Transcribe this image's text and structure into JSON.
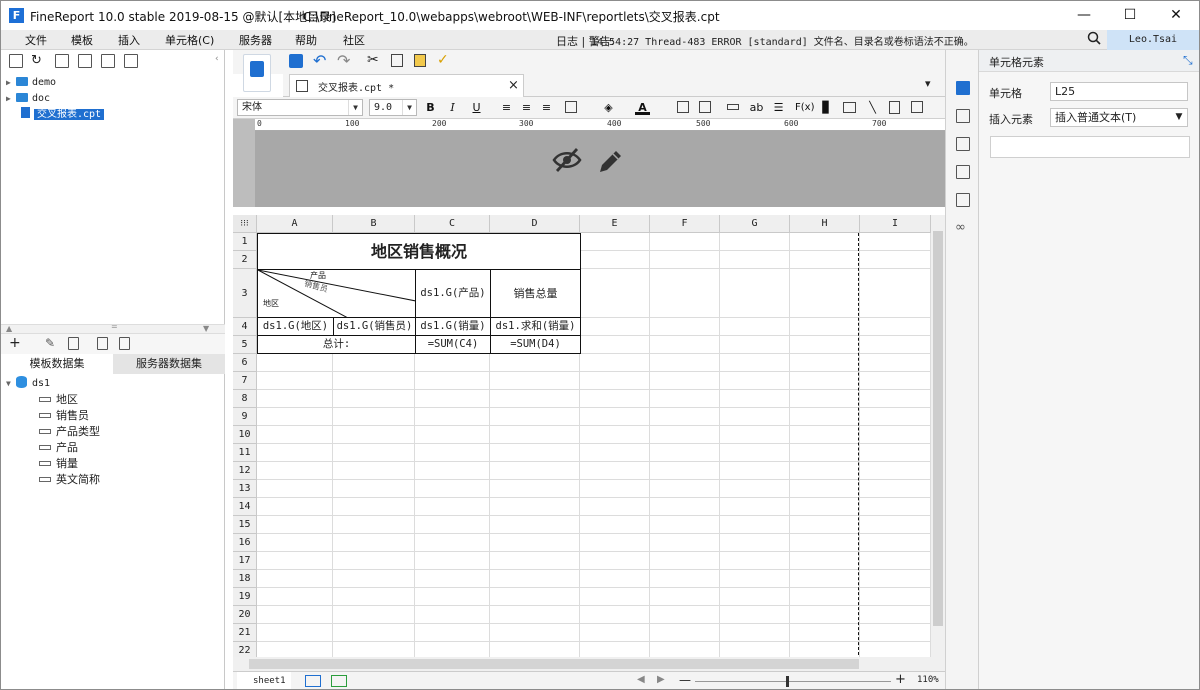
{
  "window": {
    "title": "FineReport 10.0 stable 2019-08-15 @默认[本地目录]",
    "path": "C:\\FineReport_10.0\\webapps\\webroot\\WEB-INF\\reportlets\\交叉报表.cpt",
    "minimize": "—",
    "maximize": "☐",
    "close": "✕",
    "logo": "F"
  },
  "menu": {
    "items": [
      "文件",
      "模板",
      "插入",
      "单元格(C)",
      "服务器",
      "帮助",
      "社区"
    ],
    "log_label": "日志 | 警告:",
    "warning": "14:54:27 Thread-483 ERROR [standard] 文件名、目录名或卷标语法不正确。",
    "user": "Leo.Tsai"
  },
  "file_tree": {
    "items": [
      {
        "label": "demo",
        "type": "folder"
      },
      {
        "label": "doc",
        "type": "folder"
      },
      {
        "label": "交叉报表.cpt",
        "type": "file",
        "selected": true
      }
    ]
  },
  "datasets": {
    "tab_template": "模板数据集",
    "tab_server": "服务器数据集",
    "ds_name": "ds1",
    "fields": [
      "地区",
      "销售员",
      "产品类型",
      "产品",
      "销量",
      "英文简称"
    ]
  },
  "editor": {
    "file_tab": "交叉报表.cpt *",
    "font_name": "宋体",
    "font_size": "9.0",
    "ruler_labels": [
      "0",
      "100",
      "200",
      "300",
      "400",
      "500",
      "600",
      "700"
    ],
    "columns": [
      "A",
      "B",
      "C",
      "D",
      "E",
      "F",
      "G",
      "H",
      "I"
    ],
    "rows": [
      "1",
      "2",
      "3",
      "4",
      "5",
      "6",
      "7",
      "8",
      "9",
      "10",
      "11",
      "12",
      "13",
      "14",
      "15",
      "16",
      "17",
      "18",
      "19",
      "20",
      "21",
      "22"
    ],
    "report": {
      "title": "地区销售概况",
      "slash_top": "产品",
      "slash_mid": "销售员",
      "slash_bottom": "地区",
      "c3": "ds1.G(产品)",
      "d3": "销售总量",
      "a4": "ds1.G(地区)",
      "b4": "ds1.G(销售员)",
      "c4": "ds1.G(销量)",
      "d4": "ds1.求和(销量)",
      "a5": "总计:",
      "c5": "=SUM(C4)",
      "d5": "=SUM(D4)"
    },
    "sheet_tab": "sheet1",
    "zoom": "110%"
  },
  "properties": {
    "title": "单元格元素",
    "cell_label": "单元格",
    "cell_value": "L25",
    "insert_label": "插入元素",
    "insert_value": "插入普通文本(T)"
  }
}
